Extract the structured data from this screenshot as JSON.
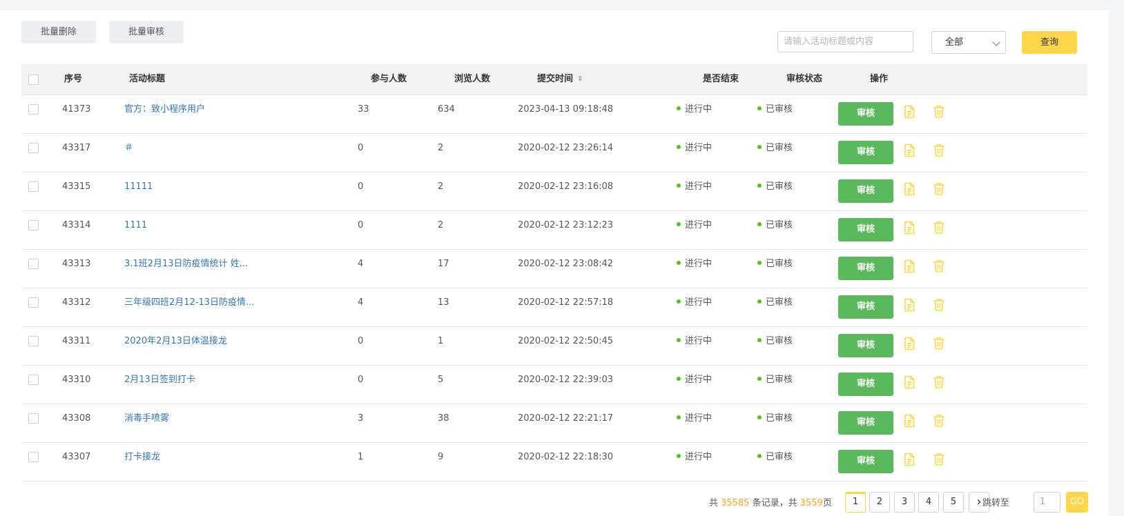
{
  "toolbar": {
    "batch_delete": "批量删除",
    "batch_audit": "批量审核",
    "search_placeholder": "请输入活动标题或内容",
    "filter_value": "全部",
    "query": "查询"
  },
  "table": {
    "headers": {
      "id": "序号",
      "title": "活动标题",
      "participants": "参与人数",
      "views": "浏览人数",
      "submit_time": "提交时间",
      "ended": "是否结束",
      "status": "审核状态",
      "actions": "操作"
    },
    "rows": [
      {
        "id": "41373",
        "title": "官方：致小程序用户",
        "participants": "33",
        "views": "634",
        "time": "2023-04-13 09:18:48",
        "ended": "进行中",
        "status": "已审核",
        "action": "审核"
      },
      {
        "id": "43317",
        "title": "＃",
        "participants": "0",
        "views": "2",
        "time": "2020-02-12 23:26:14",
        "ended": "进行中",
        "status": "已审核",
        "action": "审核"
      },
      {
        "id": "43315",
        "title": "11111",
        "participants": "0",
        "views": "2",
        "time": "2020-02-12 23:16:08",
        "ended": "进行中",
        "status": "已审核",
        "action": "审核"
      },
      {
        "id": "43314",
        "title": "1111",
        "participants": "0",
        "views": "2",
        "time": "2020-02-12 23:12:23",
        "ended": "进行中",
        "status": "已审核",
        "action": "审核"
      },
      {
        "id": "43313",
        "title": "3.1班2月13日防疫情统计 姓...",
        "participants": "4",
        "views": "17",
        "time": "2020-02-12 23:08:42",
        "ended": "进行中",
        "status": "已审核",
        "action": "审核"
      },
      {
        "id": "43312",
        "title": "三年级四班2月12-13日防疫情...",
        "participants": "4",
        "views": "13",
        "time": "2020-02-12 22:57:18",
        "ended": "进行中",
        "status": "已审核",
        "action": "审核"
      },
      {
        "id": "43311",
        "title": "2020年2月13日体温接龙",
        "participants": "0",
        "views": "1",
        "time": "2020-02-12 22:50:45",
        "ended": "进行中",
        "status": "已审核",
        "action": "审核"
      },
      {
        "id": "43310",
        "title": "2月13日签到打卡",
        "participants": "0",
        "views": "5",
        "time": "2020-02-12 22:39:03",
        "ended": "进行中",
        "status": "已审核",
        "action": "审核"
      },
      {
        "id": "43308",
        "title": "消毒手喷雾",
        "participants": "3",
        "views": "38",
        "time": "2020-02-12 22:21:17",
        "ended": "进行中",
        "status": "已审核",
        "action": "审核"
      },
      {
        "id": "43307",
        "title": "打卡接龙",
        "participants": "1",
        "views": "9",
        "time": "2020-02-12 22:18:30",
        "ended": "进行中",
        "status": "已审核",
        "action": "审核"
      }
    ]
  },
  "pagination": {
    "total_prefix": "共 ",
    "total_records": "35585",
    "records_mid": " 条记录，共 ",
    "total_pages": "3559",
    "pages_suffix": "页",
    "pages": [
      "1",
      "2",
      "3",
      "4",
      "5"
    ],
    "next": "›",
    "jump_label": "跳转至",
    "jump_value": "1",
    "go": "GO"
  },
  "colors": {
    "accent": "#fdd64a",
    "audit_button": "#5cb85c",
    "link": "#3576b5",
    "status_dot": "#52c41a",
    "highlight_number": "#f5a623"
  },
  "icons": {
    "doc": "document-icon",
    "delete": "trash-icon",
    "sort": "sort-icon",
    "dropdown": "chevron-down-icon"
  }
}
